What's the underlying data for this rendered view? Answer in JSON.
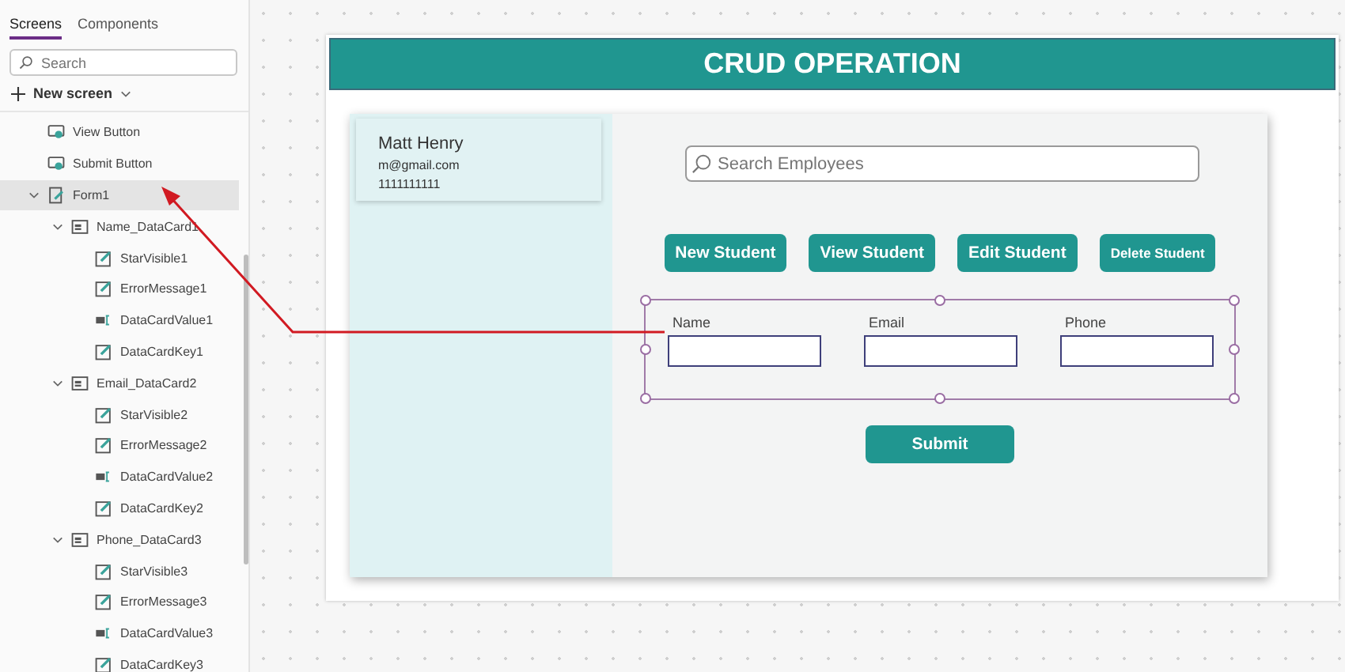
{
  "tree_view": {
    "tabs": [
      {
        "label": "Screens",
        "selected": true
      },
      {
        "label": "Components",
        "selected": false
      }
    ],
    "search": {
      "placeholder": "Search"
    },
    "new_screen": {
      "label": "New screen"
    },
    "items": [
      {
        "label": "View Button",
        "kind": "button",
        "selected": false
      },
      {
        "label": "Submit Button",
        "kind": "button",
        "selected": false
      },
      {
        "label": "Form1",
        "kind": "form",
        "selected": true,
        "expanded": true,
        "children": [
          {
            "label": "Name_DataCard1",
            "kind": "card",
            "selected": false,
            "expanded": true,
            "children": [
              {
                "label": "StarVisible1",
                "kind": "label",
                "selected": false
              },
              {
                "label": "ErrorMessage1",
                "kind": "label",
                "selected": false
              },
              {
                "label": "DataCardValue1",
                "kind": "input",
                "selected": false
              },
              {
                "label": "DataCardKey1",
                "kind": "label",
                "selected": false
              }
            ]
          },
          {
            "label": "Email_DataCard2",
            "kind": "card",
            "selected": false,
            "expanded": true,
            "children": [
              {
                "label": "StarVisible2",
                "kind": "label",
                "selected": false
              },
              {
                "label": "ErrorMessage2",
                "kind": "label",
                "selected": false
              },
              {
                "label": "DataCardValue2",
                "kind": "input",
                "selected": false
              },
              {
                "label": "DataCardKey2",
                "kind": "label",
                "selected": false
              }
            ]
          },
          {
            "label": "Phone_DataCard3",
            "kind": "card",
            "selected": false,
            "expanded": true,
            "children": [
              {
                "label": "StarVisible3",
                "kind": "label",
                "selected": false
              },
              {
                "label": "ErrorMessage3",
                "kind": "label",
                "selected": false
              },
              {
                "label": "DataCardValue3",
                "kind": "input",
                "selected": false
              },
              {
                "label": "DataCardKey3",
                "kind": "label",
                "selected": false
              }
            ]
          }
        ]
      }
    ]
  },
  "app": {
    "title": "CRUD OPERATION",
    "gallery": [
      {
        "name": "Matt Henry",
        "email": "m@gmail.com",
        "phone": "1111111111"
      }
    ],
    "search": {
      "placeholder": "Search Employees"
    },
    "buttons": [
      {
        "label": "New Student",
        "kind": "normal"
      },
      {
        "label": "View Student",
        "kind": "normal"
      },
      {
        "label": "Edit Student",
        "kind": "normal"
      },
      {
        "label": "Delete Student",
        "kind": "small"
      }
    ],
    "form": {
      "selected": true,
      "fields": [
        {
          "label": "Name"
        },
        {
          "label": "Email"
        },
        {
          "label": "Phone"
        }
      ]
    },
    "submit": {
      "label": "Submit"
    }
  }
}
